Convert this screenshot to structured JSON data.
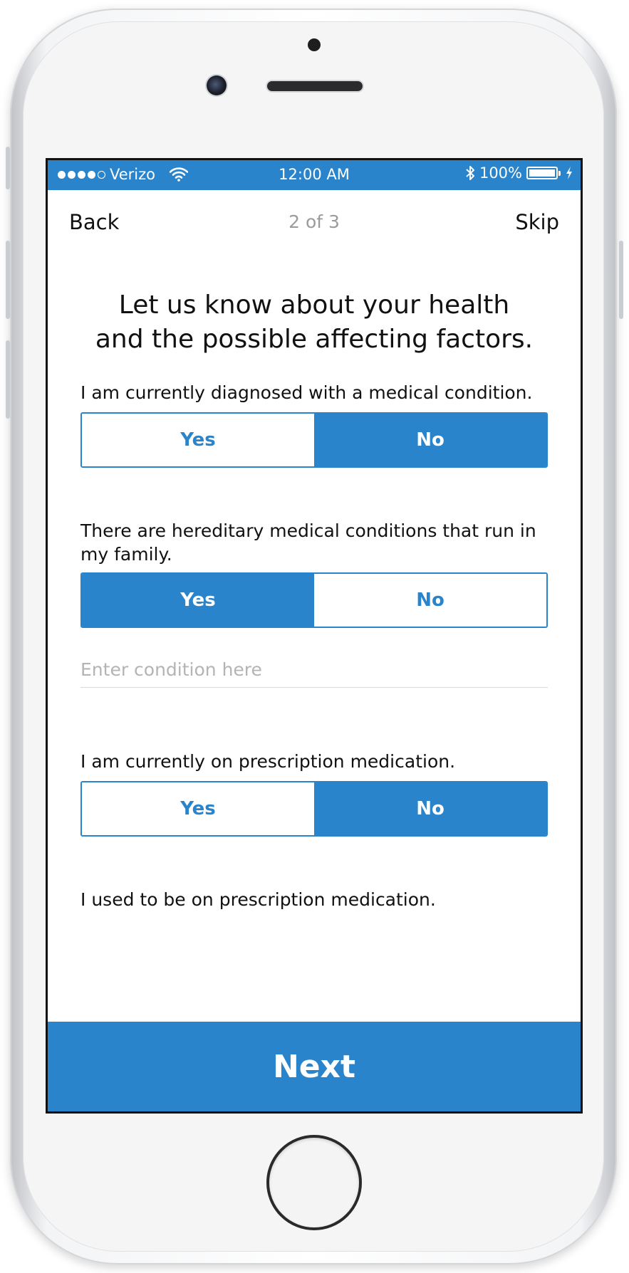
{
  "status_bar": {
    "carrier": "Verizo",
    "time": "12:00 AM",
    "battery": "100%",
    "battery_level": 1.0,
    "icons": [
      "signal-dots-icon",
      "wifi-icon",
      "bluetooth-icon",
      "battery-icon",
      "charging-bolt-icon"
    ]
  },
  "nav": {
    "back_label": "Back",
    "step_label": "2 of 3",
    "skip_label": "Skip"
  },
  "heading": {
    "line1": "Let us know about your health",
    "line2": "and the possible affecting factors."
  },
  "questions": [
    {
      "text": "I am currently diagnosed with a medical condition.",
      "yes_label": "Yes",
      "no_label": "No",
      "selected": "No"
    },
    {
      "text": "There are hereditary medical conditions that run in my family.",
      "yes_label": "Yes",
      "no_label": "No",
      "selected": "Yes"
    },
    {
      "text": "I am currently on prescription medication.",
      "yes_label": "Yes",
      "no_label": "No",
      "selected": "No"
    },
    {
      "text": "I used to be on prescription medication."
    }
  ],
  "condition_input": {
    "placeholder": "Enter condition here",
    "value": ""
  },
  "footer": {
    "next_label": "Next"
  },
  "colors": {
    "accent": "#2a84cc",
    "muted_text": "#9b9b9b",
    "placeholder": "#b4b4b4"
  }
}
